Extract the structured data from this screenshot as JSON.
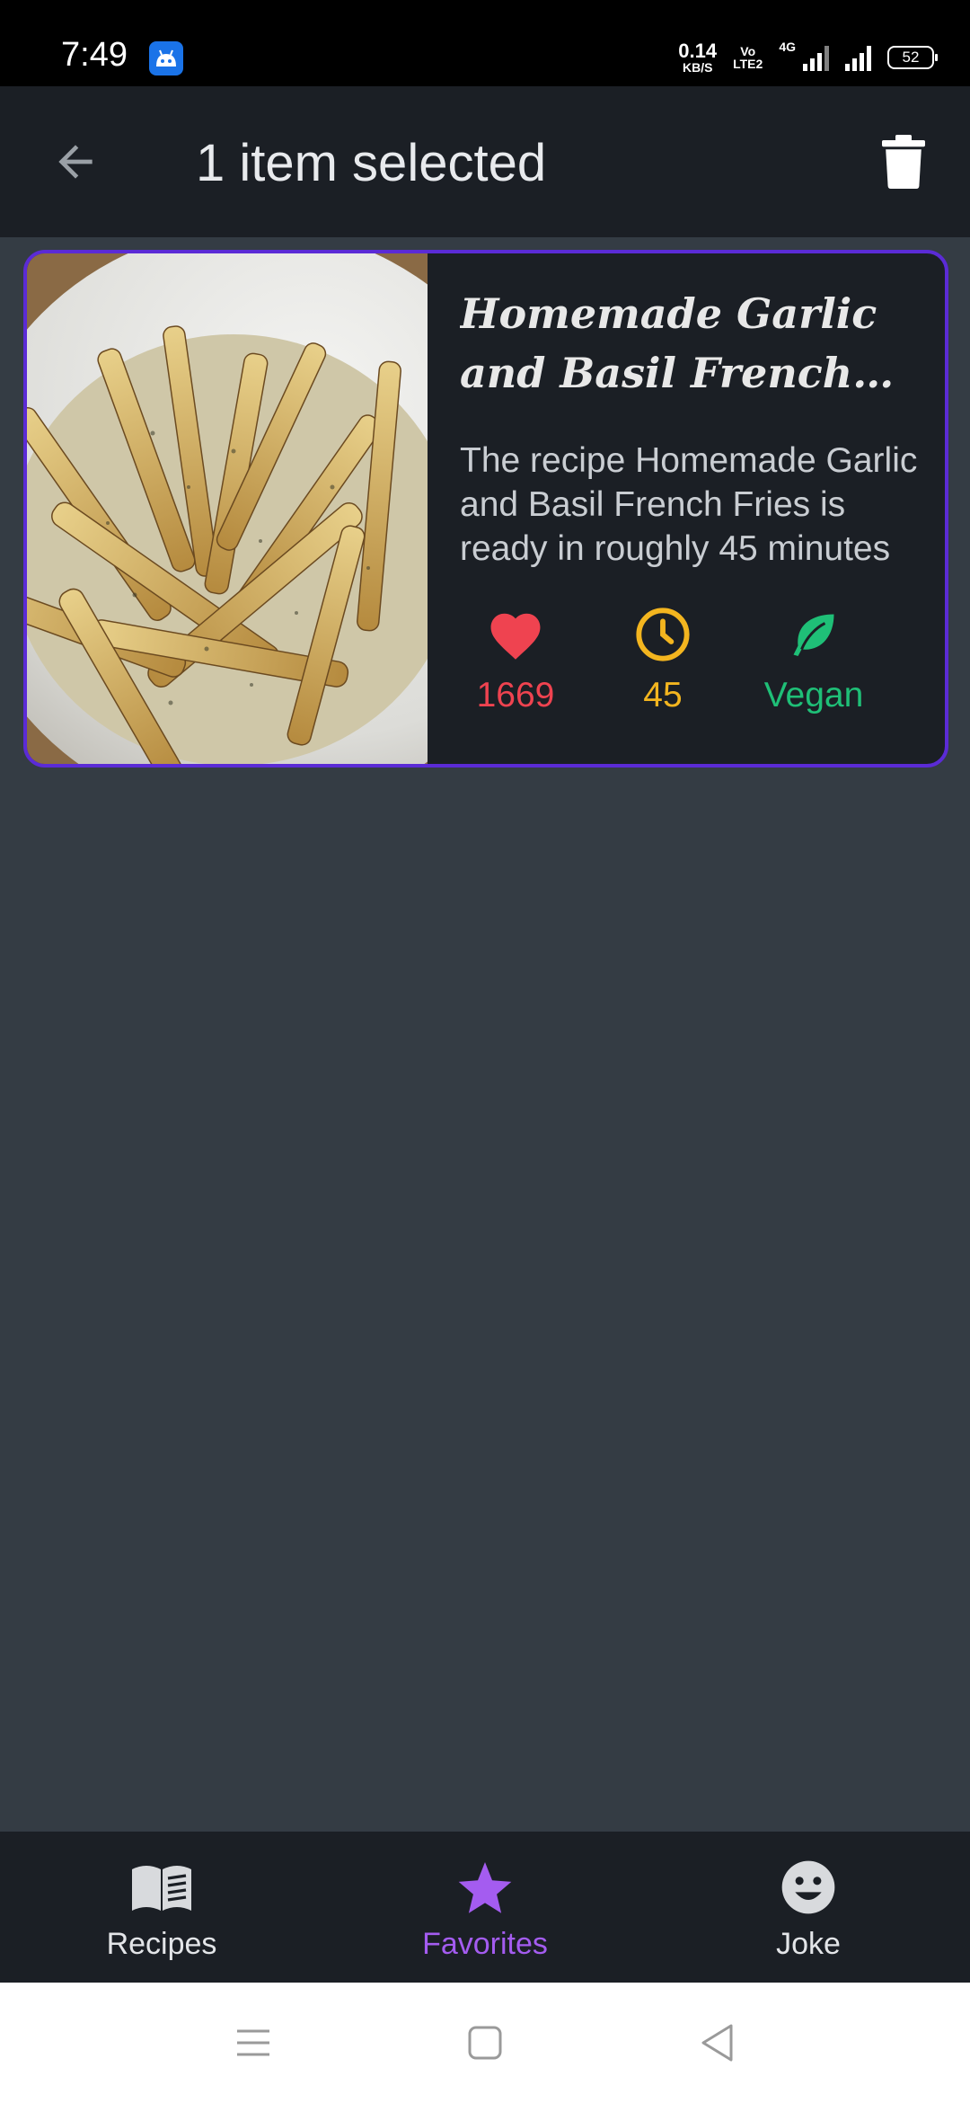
{
  "status_bar": {
    "time": "7:49",
    "speed_value": "0.14",
    "speed_unit": "KB/S",
    "volte_top": "Vo",
    "volte_bottom": "LTE2",
    "network": "4G",
    "battery": "52"
  },
  "app_bar": {
    "back_icon": "arrow-back-icon",
    "title": "1 item selected",
    "delete_icon": "trash-icon"
  },
  "recipe_card": {
    "image_description_icon": "french-fries-photo",
    "title": "Homemade Garlic and Basil French Fries",
    "description": "The recipe Homemade Garlic and Basil French Fries is ready in roughly 45 minutes",
    "likes": "1669",
    "time": "45",
    "vegan_label": "Vegan",
    "colors": {
      "border": "#5b2bd6",
      "likes": "#ef4350",
      "time": "#f3b51f",
      "vegan": "#1fbf77"
    }
  },
  "bottom_nav": {
    "items": [
      {
        "label": "Recipes",
        "icon": "book-icon",
        "selected": false
      },
      {
        "label": "Favorites",
        "icon": "star-icon",
        "selected": true
      },
      {
        "label": "Joke",
        "icon": "smiley-icon",
        "selected": false
      }
    ],
    "accent": "#a45cf0"
  },
  "system_nav": {
    "icons": [
      "menu-icon",
      "home-icon",
      "back-triangle-icon"
    ]
  }
}
